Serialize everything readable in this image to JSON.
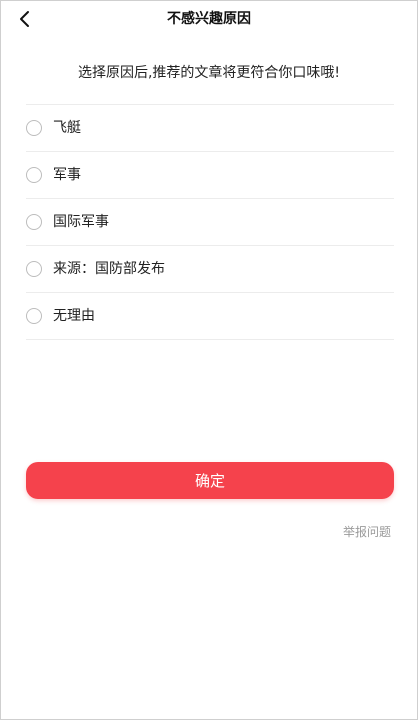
{
  "header": {
    "title": "不感兴趣原因",
    "back_icon": "chevron-left-icon"
  },
  "subtitle": "选择原因后,推荐的文章将更符合你口味哦!",
  "options": [
    {
      "label": "飞艇"
    },
    {
      "label": "军事"
    },
    {
      "label": "国际军事"
    },
    {
      "label": "来源：国防部发布"
    },
    {
      "label": "无理由"
    }
  ],
  "confirm_label": "确定",
  "report_label": "举报问题",
  "colors": {
    "accent": "#f5424c",
    "muted_text": "#9a9a9a",
    "divider": "#ececec"
  }
}
